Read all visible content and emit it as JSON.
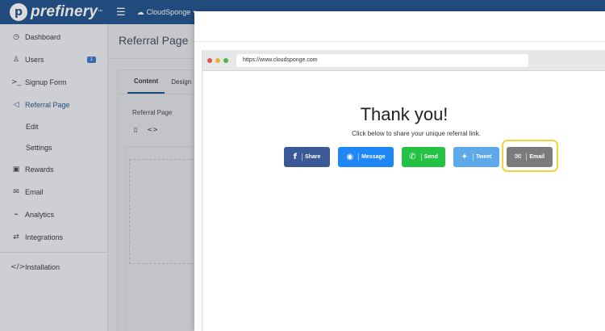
{
  "topbar": {
    "brand": "prefinery",
    "brand_tm": "™",
    "menu_icon": "☰",
    "account": "CloudSponge",
    "account_caret": "▾"
  },
  "sidebar": {
    "items": [
      {
        "icon": "◷",
        "label": "Dashboard"
      },
      {
        "icon": "♙",
        "label": "Users",
        "badge": "1"
      },
      {
        "icon": ">_",
        "label": "Signup Form"
      },
      {
        "icon": "◁",
        "label": "Referral Page"
      },
      {
        "label": "Edit"
      },
      {
        "label": "Settings"
      },
      {
        "icon": "▣",
        "label": "Rewards"
      },
      {
        "icon": "✉",
        "label": "Email"
      },
      {
        "icon": "⌁",
        "label": "Analytics"
      },
      {
        "icon": "⇄",
        "label": "Integrations"
      },
      {
        "icon": "</>",
        "label": "Installation"
      }
    ]
  },
  "main": {
    "title": "Referral Page",
    "tabs": [
      "Content",
      "Design"
    ],
    "card_label": "Referral Page",
    "tools": [
      "▯",
      "<>"
    ]
  },
  "browser": {
    "url": "https://www.cloudsponge.com"
  },
  "thankyou": {
    "title": "Thank you!",
    "subtitle": "Click below to share your unique referral link."
  },
  "share_buttons": [
    {
      "label": "Share",
      "icon": "f",
      "color": "#3b5997"
    },
    {
      "label": "Message",
      "icon": "◉",
      "color": "#1e86f5"
    },
    {
      "label": "Send",
      "icon": "✆",
      "color": "#25c145"
    },
    {
      "label": "Tweet",
      "icon": "✦",
      "color": "#5ea9ea"
    },
    {
      "label": "Email",
      "icon": "✉",
      "color": "#7b7b7b"
    }
  ],
  "highlight_color": "#f2d33f"
}
